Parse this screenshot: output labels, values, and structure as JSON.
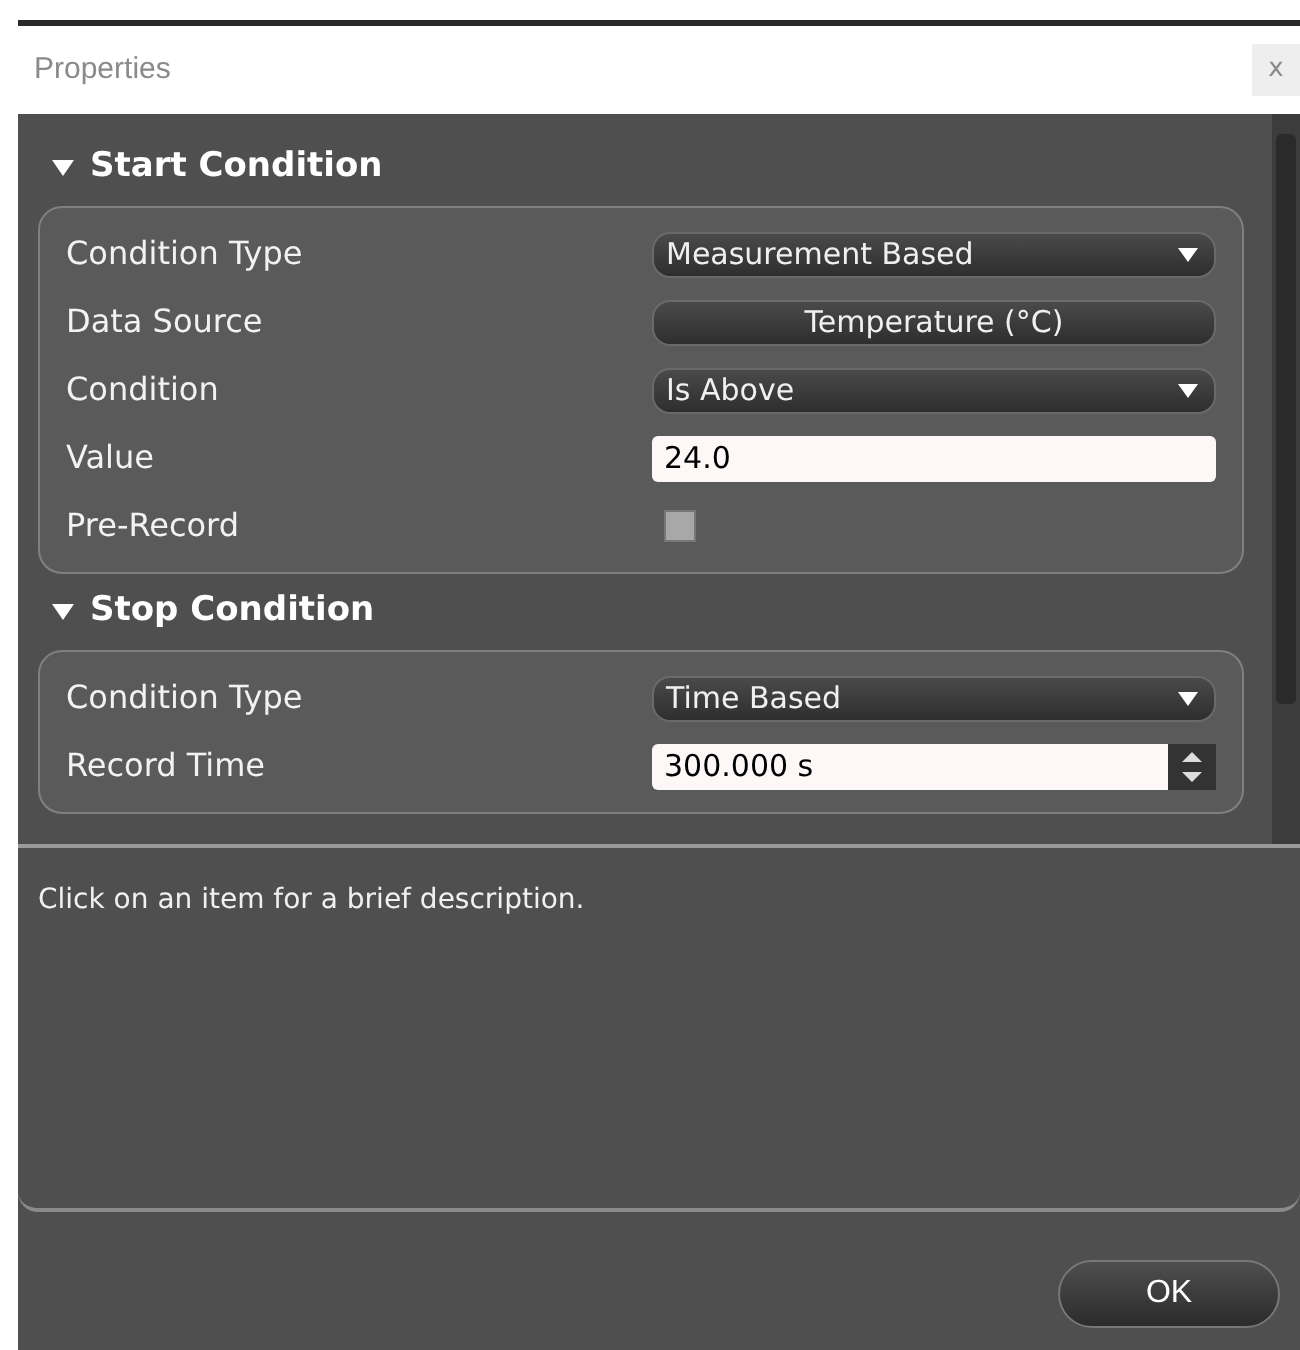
{
  "window": {
    "title": "Properties",
    "close": "x"
  },
  "sections": [
    {
      "title": "Start Condition",
      "expanded": true,
      "rows": [
        {
          "label": "Condition Type",
          "kind": "dropdown",
          "value": "Measurement Based"
        },
        {
          "label": "Data Source",
          "kind": "button",
          "value": "Temperature (°C)"
        },
        {
          "label": "Condition",
          "kind": "dropdown",
          "value": "Is Above"
        },
        {
          "label": "Value",
          "kind": "text",
          "value": "24.0"
        },
        {
          "label": "Pre-Record",
          "kind": "checkbox",
          "checked": false
        }
      ]
    },
    {
      "title": "Stop Condition",
      "expanded": true,
      "rows": [
        {
          "label": "Condition Type",
          "kind": "dropdown",
          "value": "Time Based"
        },
        {
          "label": "Record Time",
          "kind": "spin",
          "value": "300.000 s"
        }
      ]
    }
  ],
  "description": "Click on an item for a brief description.",
  "buttons": [
    "OK"
  ]
}
